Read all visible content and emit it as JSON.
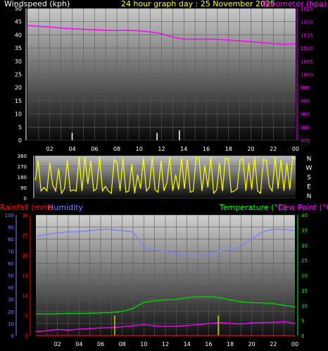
{
  "header": {
    "windspeed_label": "Windspeed (kph)",
    "title": "24 hour graph day : 25 November 2025",
    "barometer_label": "Barometer (hpa)",
    "rainfall_label": "Rainfall (mm)",
    "humidity_label": "Humidity",
    "temperature_label": "Temperature (°C)",
    "dewpoint_label": "Dew Point (°C)"
  },
  "colors": {
    "windspeed": "#ffffff",
    "barometer": "#ff00ff",
    "winddir": "#ffff00",
    "rainfall": "#ff0000",
    "humidity": "#7f7fff",
    "temperature": "#00cc00",
    "dewpoint": "#ee00ee",
    "rain_bars": "#cccc00",
    "compass": "#ffffff"
  },
  "x_ticks": [
    "02",
    "04",
    "06",
    "08",
    "10",
    "12",
    "14",
    "16",
    "18",
    "20",
    "22",
    "00"
  ],
  "compass": [
    "N",
    "W",
    "S",
    "E",
    "N"
  ],
  "chart_data": [
    {
      "type": "line",
      "title": "24 hour graph day : 25 November 2025",
      "x": [
        0,
        1,
        2,
        3,
        4,
        5,
        6,
        7,
        8,
        9,
        10,
        11,
        12,
        13,
        14,
        15,
        16,
        17,
        18,
        19,
        20,
        21,
        22,
        23,
        24
      ],
      "y_left_ticks": [
        "50",
        "45",
        "40",
        "35",
        "30",
        "25",
        "20",
        "15",
        "10",
        "5",
        "0"
      ],
      "y_right_ticks": [
        "1025",
        "1020",
        "1015",
        "1010",
        "1005",
        "1000",
        "995",
        "990",
        "985",
        "980",
        "975"
      ],
      "ylim_left": [
        0,
        50
      ],
      "ylim_right": [
        975,
        1025
      ],
      "series": [
        {
          "name": "Windspeed (kph)",
          "axis": "left",
          "gust_points": [
            [
              4.0,
              2
            ],
            [
              11.6,
              2
            ],
            [
              13.6,
              3
            ]
          ]
        },
        {
          "name": "Barometer (hpa)",
          "axis": "right",
          "values": [
            1018.5,
            1018.2,
            1018.0,
            1017.6,
            1017.3,
            1017.1,
            1016.9,
            1016.7,
            1016.6,
            1016.7,
            1016.5,
            1016.1,
            1015.4,
            1014.1,
            1013.4,
            1013.3,
            1013.4,
            1013.3,
            1013.0,
            1012.7,
            1012.4,
            1012.0,
            1011.7,
            1011.4,
            1011.6
          ]
        }
      ]
    },
    {
      "type": "scatter",
      "x_label_ticks": [
        "02",
        "04",
        "06",
        "08",
        "10",
        "12",
        "14",
        "16",
        "18",
        "20",
        "22",
        "00"
      ],
      "y_ticks": [
        "360",
        "270",
        "180",
        "90",
        "0"
      ],
      "ylim": [
        0,
        360
      ],
      "series": [
        {
          "name": "Wind direction",
          "values": [
            150,
            320,
            60,
            90,
            60,
            300,
            110,
            60,
            250,
            40,
            80,
            320,
            60,
            70,
            60,
            350,
            60,
            350,
            120,
            320,
            60,
            80,
            350,
            60,
            100,
            60,
            40,
            330,
            300,
            60,
            340,
            50,
            60,
            290,
            40,
            200,
            80,
            340,
            60,
            90,
            350,
            70,
            50,
            320,
            60,
            130,
            350,
            60,
            200,
            70,
            340,
            80,
            330,
            50,
            60,
            350,
            340,
            60,
            280,
            90,
            350,
            40,
            70,
            300,
            60,
            340,
            330,
            50,
            60,
            80,
            320,
            340,
            60,
            300,
            70,
            350,
            60,
            40,
            330,
            320,
            100,
            60,
            350,
            80,
            330,
            60,
            300,
            70,
            350,
            330
          ]
        }
      ]
    },
    {
      "type": "line",
      "x": [
        0,
        1,
        2,
        3,
        4,
        5,
        6,
        7,
        8,
        9,
        10,
        11,
        12,
        13,
        14,
        15,
        16,
        17,
        18,
        19,
        20,
        21,
        22,
        23,
        24
      ],
      "y_left_ticks": [
        "100",
        "90",
        "80",
        "70",
        "60",
        "50",
        "40",
        "30",
        "20",
        "10",
        "0"
      ],
      "y_mid_ticks": [
        "30",
        "25",
        "20",
        "15",
        "10",
        "5",
        "0"
      ],
      "y_right_ticks": [
        "40",
        "35",
        "30",
        "25",
        "20",
        "15",
        "10",
        "5",
        "0"
      ],
      "ylim_humidity": [
        0,
        100
      ],
      "ylim_rain": [
        0,
        30
      ],
      "ylim_temp": [
        0,
        40
      ],
      "series": [
        {
          "name": "Humidity",
          "axis": "humidity",
          "values": [
            82,
            84,
            85,
            86,
            86,
            87,
            88,
            88,
            87,
            86,
            73,
            71,
            70,
            68,
            66,
            66,
            67,
            70,
            71,
            74,
            80,
            86,
            88,
            88,
            87
          ]
        },
        {
          "name": "Temperature (°C)",
          "axis": "temp",
          "values": [
            7.2,
            7.1,
            7.2,
            7.3,
            7.3,
            7.4,
            7.5,
            7.6,
            8.0,
            9.0,
            11.0,
            11.5,
            11.8,
            12.0,
            12.6,
            12.8,
            12.9,
            12.6,
            11.8,
            11.2,
            10.9,
            10.8,
            10.6,
            10.0,
            9.5
          ]
        },
        {
          "name": "Dew Point (°C)",
          "axis": "temp",
          "values": [
            1.3,
            1.6,
            2.0,
            1.8,
            2.1,
            2.3,
            2.5,
            2.6,
            2.9,
            3.2,
            3.6,
            3.2,
            3.0,
            3.1,
            3.3,
            3.6,
            3.9,
            4.3,
            4.0,
            3.8,
            4.2,
            4.3,
            4.4,
            4.6,
            4.0
          ]
        },
        {
          "name": "Rainfall (mm)",
          "axis": "rain",
          "bars": [
            [
              7.3,
              5
            ],
            [
              16.9,
              5
            ]
          ]
        }
      ]
    }
  ]
}
